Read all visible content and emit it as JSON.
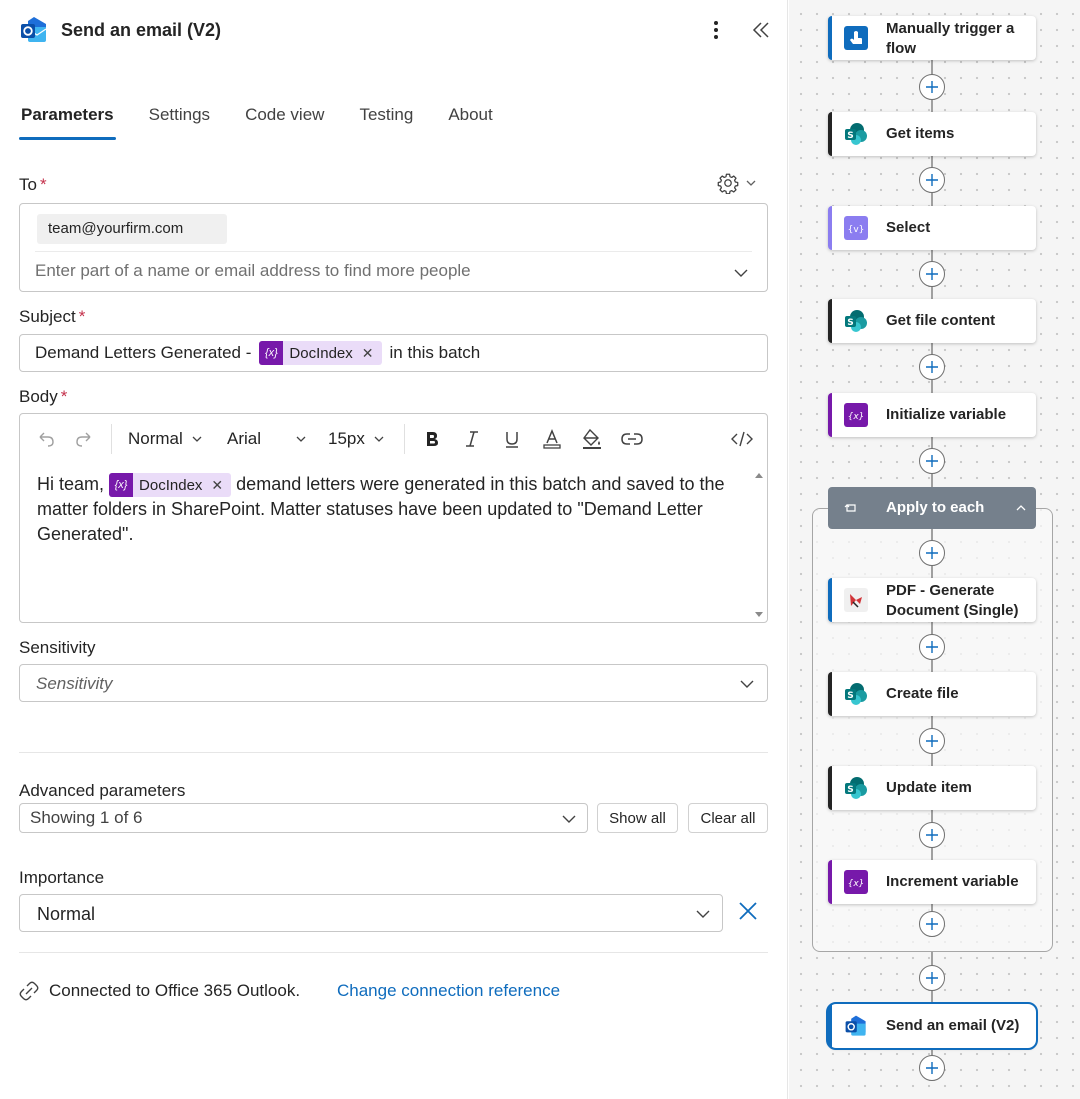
{
  "header": {
    "title": "Send an email (V2)"
  },
  "tabs": [
    {
      "label": "Parameters",
      "active": true
    },
    {
      "label": "Settings"
    },
    {
      "label": "Code view"
    },
    {
      "label": "Testing"
    },
    {
      "label": "About"
    }
  ],
  "to": {
    "label": "To",
    "required_mark": "*",
    "chip": "team@yourfirm.com",
    "placeholder": "Enter part of a name or email address to find more people"
  },
  "subject": {
    "label": "Subject",
    "required_mark": "*",
    "prefix": "Demand Letters Generated -",
    "token": "DocIndex",
    "suffix": "in this batch"
  },
  "body": {
    "label": "Body",
    "required_mark": "*",
    "toolbar": {
      "style": "Normal",
      "font": "Arial",
      "size": "15px"
    },
    "text_before": "Hi team,",
    "token": "DocIndex",
    "text_after": "demand letters were generated in this batch and saved to the matter folders in SharePoint. Matter statuses have been updated to \"Demand Letter Generated\"."
  },
  "sensitivity": {
    "label": "Sensitivity",
    "placeholder": "Sensitivity"
  },
  "advanced": {
    "label": "Advanced parameters",
    "value": "Showing 1 of 6",
    "show_all": "Show all",
    "clear_all": "Clear all"
  },
  "importance": {
    "label": "Importance",
    "value": "Normal"
  },
  "connection": {
    "text": "Connected to Office 365 Outlook.",
    "link": "Change connection reference"
  },
  "token_icon_text": "{x}",
  "flow": {
    "nodes": [
      {
        "label_line1": "Manually trigger a",
        "label_line2": "flow"
      },
      {
        "label": "Get items"
      },
      {
        "label": "Select"
      },
      {
        "label": "Get file content"
      },
      {
        "label": "Initialize variable"
      },
      {
        "label": "Apply to each"
      },
      {
        "label_line1": "PDF - Generate",
        "label_line2": "Document (Single)"
      },
      {
        "label": "Create file"
      },
      {
        "label": "Update item"
      },
      {
        "label": "Increment variable"
      },
      {
        "label": "Send an email (V2)"
      }
    ]
  },
  "colors": {
    "accent": "#0f6cbd",
    "variable": "#7719aa",
    "sharepoint": "#03787c",
    "required": "#c4314b",
    "loop_header": "#75808c"
  }
}
